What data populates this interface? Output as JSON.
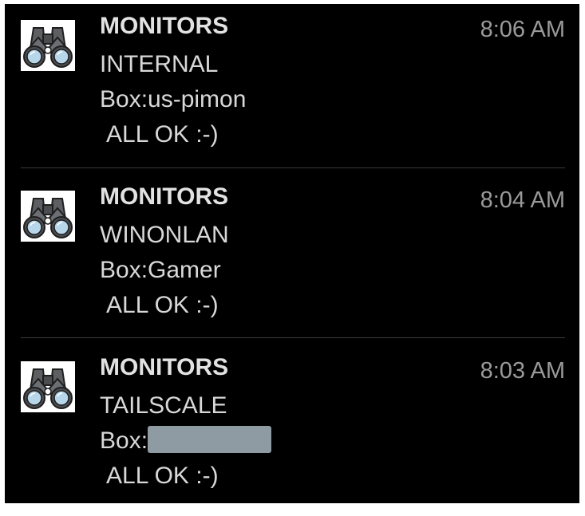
{
  "notifications": [
    {
      "app_name": "MONITORS",
      "time": "8:06 AM",
      "title": "INTERNAL",
      "box_line": "Box:us-pimon",
      "status": "ALL OK :-)",
      "icon": "binoculars-icon"
    },
    {
      "app_name": "MONITORS",
      "time": "8:04 AM",
      "title": "WINONLAN",
      "box_line": "Box:Gamer",
      "status": "ALL OK :-)",
      "icon": "binoculars-icon"
    },
    {
      "app_name": "MONITORS",
      "time": "8:03 AM",
      "title": "TAILSCALE",
      "box_prefix": "Box:",
      "status": "ALL OK :-)",
      "icon": "binoculars-icon"
    }
  ],
  "colors": {
    "background": "#000000",
    "primary_text": "#d8d8d8",
    "time_text": "#9a9a9a",
    "divider": "#3b3b3b",
    "redaction": "#8e9ba3"
  }
}
